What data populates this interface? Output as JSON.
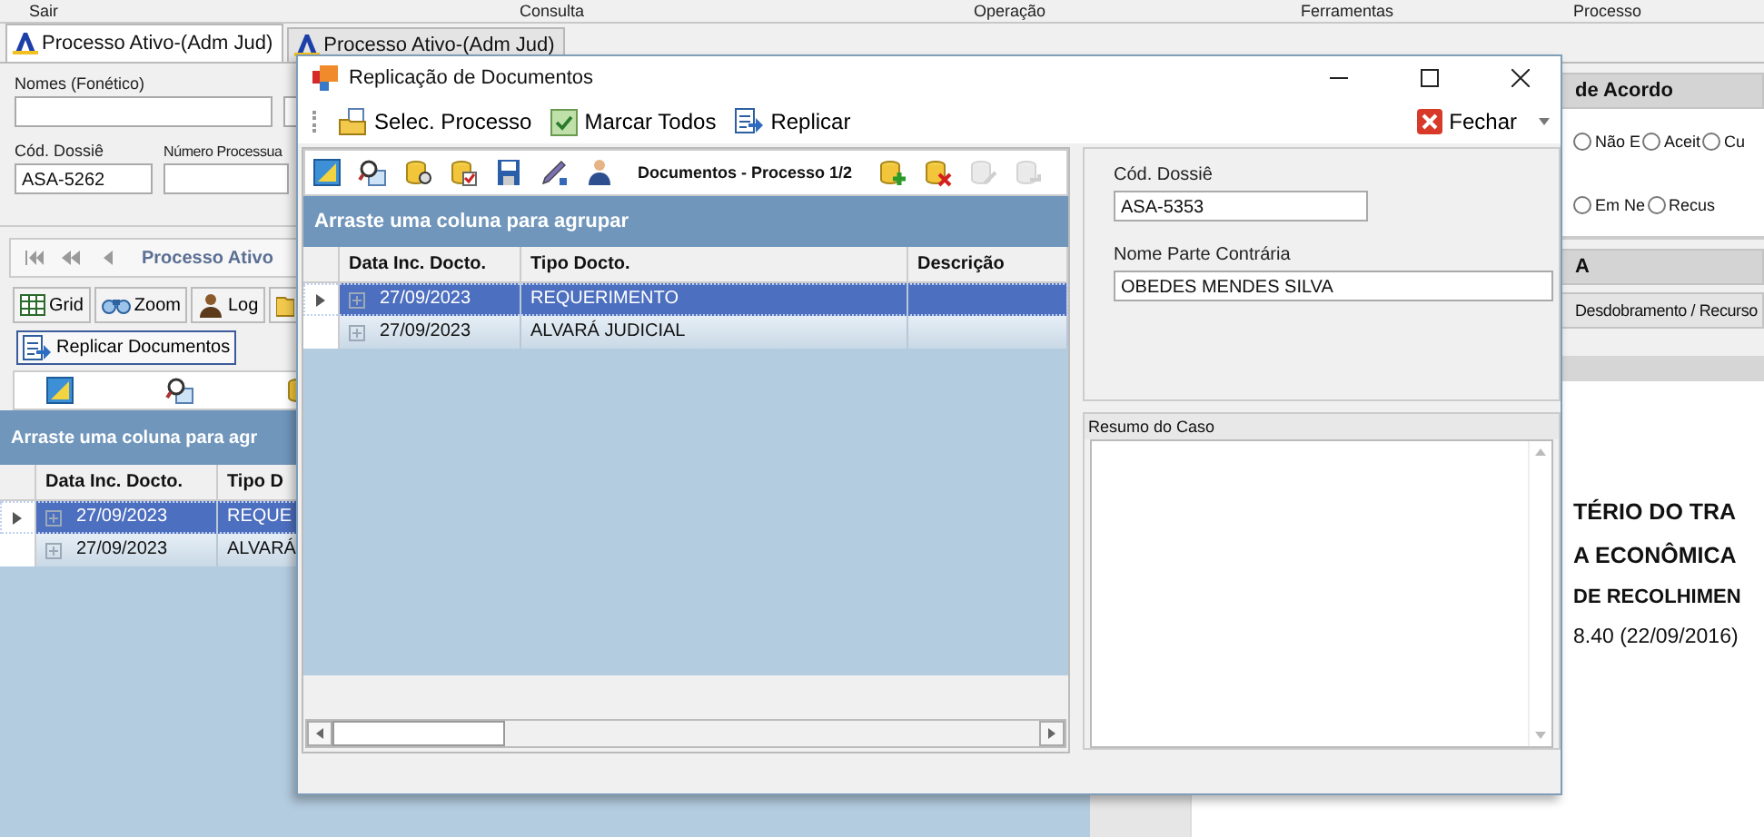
{
  "menu": [
    "Sair",
    "Consulta",
    "Operação",
    "Ferramentas",
    "Processo"
  ],
  "tabs": [
    {
      "label": "Processo Ativo-(Adm Jud)",
      "selected": true
    },
    {
      "label": "Processo Ativo-(Adm Jud)",
      "selected": false
    }
  ],
  "form": {
    "names_label": "Nomes (Fonético)",
    "dossier_label": "Cód. Dossiê",
    "dossier_value": "ASA-5262",
    "process_label": "Número Processua"
  },
  "navigator": {
    "title": "Processo Ativo"
  },
  "toolbar": [
    {
      "kind": "grid",
      "label": "Grid"
    },
    {
      "kind": "zoom",
      "label": "Zoom"
    },
    {
      "kind": "log",
      "label": "Log"
    },
    {
      "kind": "folder"
    }
  ],
  "replicate_button": "Replicar Documentos",
  "left_grid": {
    "group_hint": "Arraste uma coluna para agr",
    "columns": [
      "Data Inc. Docto.",
      "Tipo D"
    ],
    "rows": [
      {
        "date": "27/09/2023",
        "type": "REQUE",
        "selected": true
      },
      {
        "date": "27/09/2023",
        "type": "ALVARÁ",
        "selected": false
      }
    ]
  },
  "agreement": {
    "title": "de Acordo",
    "radios": [
      {
        "label": "Não E",
        "selected": false
      },
      {
        "label": "Aceit",
        "selected": false
      },
      {
        "label": "Cu",
        "selected": false
      },
      {
        "label": "Em Ne",
        "selected": false
      },
      {
        "label": "Recus",
        "selected": false
      }
    ]
  },
  "section_title": "A",
  "subtab": "Desdobramento / Recurso",
  "document_lines": [
    {
      "text": "TÉRIO DO TRA",
      "kind": "heading"
    },
    {
      "text": "A ECONÔMICA",
      "kind": "heading"
    },
    {
      "text": "DE RECOLHIMEN",
      "kind": "subheading"
    },
    {
      "text": "8.40 (22/09/2016)",
      "kind": "plain"
    }
  ],
  "dialog": {
    "title": "Replicação de Documentos",
    "actions": [
      {
        "kind": "select",
        "label": "Selec. Processo"
      },
      {
        "kind": "check",
        "label": "Marcar Todos"
      },
      {
        "kind": "replicate",
        "label": "Replicar"
      }
    ],
    "close_label": "Fechar",
    "grid_toolbar": {
      "title": "Documentos - Processo 1/2",
      "left_icons": [
        {
          "kind": "ruler",
          "disabled": false
        },
        {
          "kind": "search",
          "disabled": false
        },
        {
          "kind": "db-search",
          "disabled": false
        },
        {
          "kind": "db-check",
          "disabled": false
        },
        {
          "kind": "disk",
          "disabled": false
        },
        {
          "kind": "pen",
          "disabled": false
        },
        {
          "kind": "person",
          "disabled": false
        }
      ],
      "right_icons": [
        {
          "kind": "db-add",
          "disabled": false
        },
        {
          "kind": "db-delete",
          "disabled": false
        },
        {
          "kind": "db-edit",
          "disabled": true
        },
        {
          "kind": "db-undo",
          "disabled": true
        }
      ]
    },
    "group_hint": "Arraste uma coluna para agrupar",
    "columns": [
      "Data Inc. Docto.",
      "Tipo Docto.",
      "Descrição"
    ],
    "rows": [
      {
        "date": "27/09/2023",
        "type": "REQUERIMENTO",
        "description": "",
        "selected": true
      },
      {
        "date": "27/09/2023",
        "type": "ALVARÁ JUDICIAL",
        "description": "",
        "selected": false
      }
    ],
    "dossier_label": "Cód. Dossiê",
    "dossier_value": "ASA-5353",
    "party_label": "Nome Parte Contrária",
    "party_value": "OBEDES MENDES SILVA",
    "summary_label": "Resumo do Caso"
  }
}
